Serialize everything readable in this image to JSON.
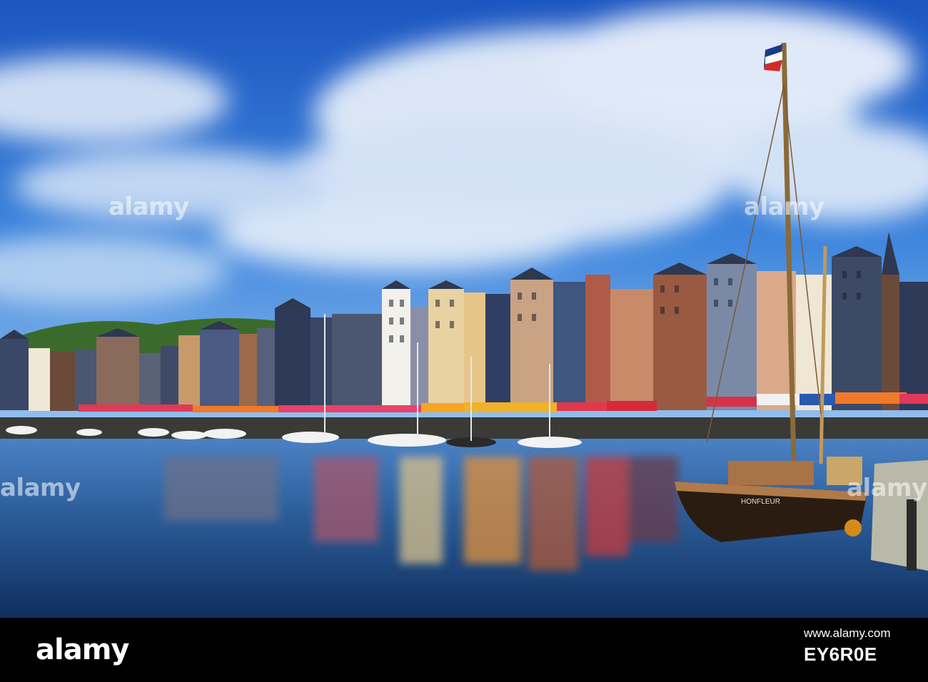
{
  "watermark": {
    "text": "alamy"
  },
  "footer": {
    "logo_text": "alamy",
    "website": "www.alamy.com",
    "image_id": "EY6R0E"
  },
  "photo": {
    "boat_name": "HONFLEUR",
    "colors": {
      "sky_top": "#1f5fc8",
      "sky_low": "#6fa9e6",
      "cloud": "#ffffff",
      "water": "#2a5e9a",
      "slate": "#3c4a66",
      "hull": "#2b1c12"
    }
  }
}
